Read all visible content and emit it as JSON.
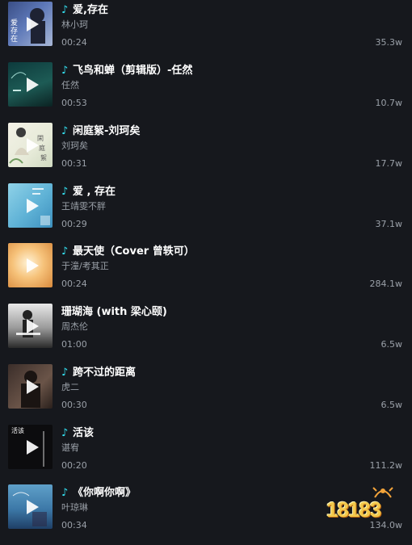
{
  "songs": [
    {
      "title": "爱,存在",
      "artist": "林小珂",
      "duration": "00:24",
      "count": "35.3w"
    },
    {
      "title": "飞鸟和蝉（剪辑版）-任然",
      "artist": "任然",
      "duration": "00:53",
      "count": "10.7w"
    },
    {
      "title": "闲庭絮-刘珂矣",
      "artist": "刘珂矣",
      "duration": "00:31",
      "count": "17.7w"
    },
    {
      "title": "爱 , 存在",
      "artist": "王靖雯不胖",
      "duration": "00:29",
      "count": "37.1w"
    },
    {
      "title": "最天使（Cover 曾轶可）",
      "artist": "于潼/考其正",
      "duration": "00:24",
      "count": "284.1w"
    },
    {
      "title": "珊瑚海 (with 梁心颐)",
      "artist": "周杰伦",
      "duration": "01:00",
      "count": "6.5w"
    },
    {
      "title": "跨不过的距离",
      "artist": "虎二",
      "duration": "00:30",
      "count": "6.5w"
    },
    {
      "title": "活该",
      "artist": "谌宥",
      "duration": "00:20",
      "count": "111.2w"
    },
    {
      "title": "《你啊你啊》",
      "artist": "叶琼琳",
      "duration": "00:34",
      "count": "134.0w"
    }
  ],
  "cover_text": {
    "0": "爱存在",
    "7": "活该"
  },
  "watermark": "18183",
  "colors": {
    "accent": "#34e1f2",
    "background": "#16181d"
  }
}
